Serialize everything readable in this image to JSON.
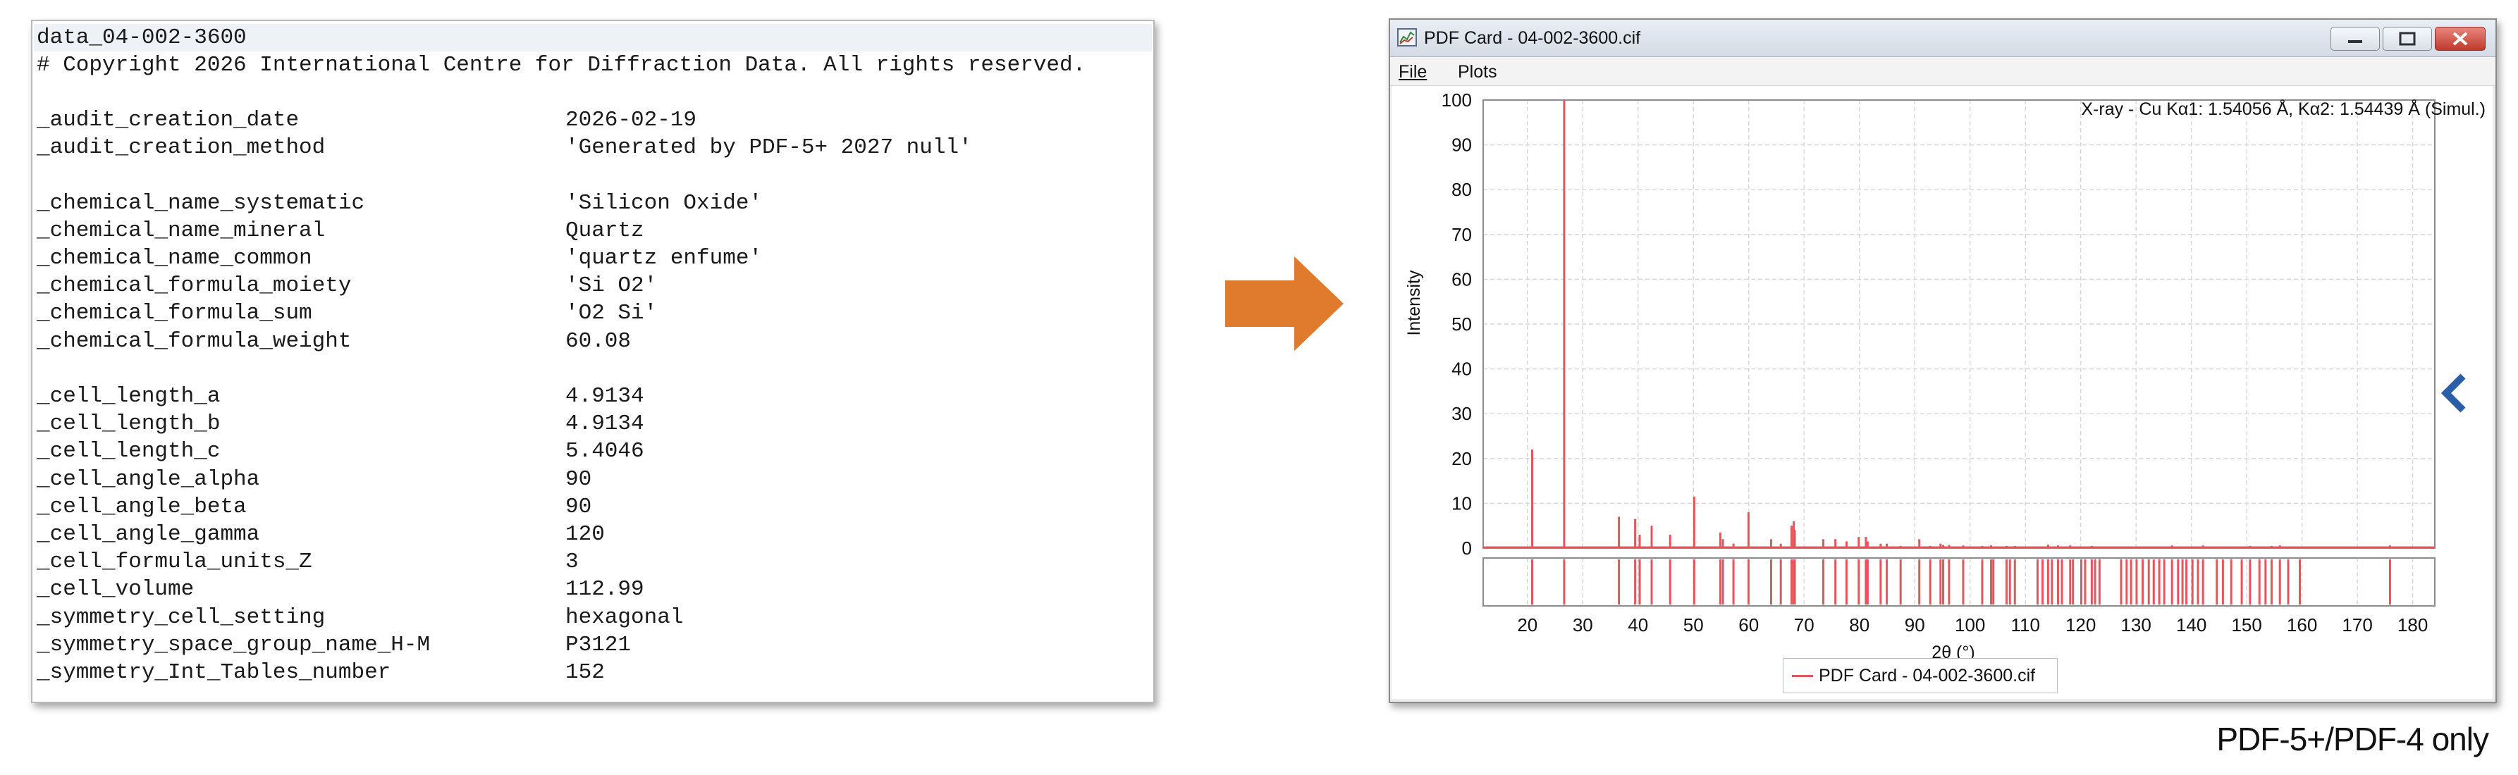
{
  "cif": {
    "header": "data_04-002-3600",
    "copyright": "# Copyright 2026 International Centre for Diffraction Data. All rights reserved.",
    "lines": [
      {
        "key": "_audit_creation_date",
        "value": "2026-02-19"
      },
      {
        "key": "_audit_creation_method",
        "value": "'Generated by PDF-5+ 2027 null'"
      },
      {
        "key": "",
        "value": ""
      },
      {
        "key": "_chemical_name_systematic",
        "value": "'Silicon Oxide'"
      },
      {
        "key": "_chemical_name_mineral",
        "value": "Quartz"
      },
      {
        "key": "_chemical_name_common",
        "value": "'quartz enfume'"
      },
      {
        "key": "_chemical_formula_moiety",
        "value": "'Si O2'"
      },
      {
        "key": "_chemical_formula_sum",
        "value": "'O2 Si'"
      },
      {
        "key": "_chemical_formula_weight",
        "value": "60.08"
      },
      {
        "key": "",
        "value": ""
      },
      {
        "key": "_cell_length_a",
        "value": "4.9134"
      },
      {
        "key": "_cell_length_b",
        "value": "4.9134"
      },
      {
        "key": "_cell_length_c",
        "value": "5.4046"
      },
      {
        "key": "_cell_angle_alpha",
        "value": "90"
      },
      {
        "key": "_cell_angle_beta",
        "value": "90"
      },
      {
        "key": "_cell_angle_gamma",
        "value": "120"
      },
      {
        "key": "_cell_formula_units_Z",
        "value": "3"
      },
      {
        "key": "_cell_volume",
        "value": "112.99"
      },
      {
        "key": "_symmetry_cell_setting",
        "value": "hexagonal"
      },
      {
        "key": "_symmetry_space_group_name_H-M",
        "value": "P3121"
      },
      {
        "key": "_symmetry_Int_Tables_number",
        "value": "152"
      }
    ]
  },
  "arrow": {
    "icon": "right-arrow-icon",
    "color": "#e07b2e"
  },
  "pdf_window": {
    "title": "PDF Card - 04-002-3600.cif",
    "menu": {
      "file": "File",
      "plots": "Plots"
    },
    "colors": {
      "peak": "#e8545c",
      "grid": "#d9d9d9",
      "chevron": "#2a5fa8"
    }
  },
  "chart_data": {
    "type": "line",
    "annotation": "X-ray - Cu Kα1: 1.54056 Å, Kα2: 1.54439 Å (Simul.)",
    "xlabel": "2θ (°)",
    "ylabel": "Intensity",
    "xlim": [
      12,
      184
    ],
    "ylim": [
      0,
      100
    ],
    "x_ticks": [
      20,
      30,
      40,
      50,
      60,
      70,
      80,
      90,
      100,
      110,
      120,
      130,
      140,
      150,
      160,
      170,
      180
    ],
    "y_ticks": [
      0,
      10,
      20,
      30,
      40,
      50,
      60,
      70,
      80,
      90,
      100
    ],
    "grid": true,
    "legend": "bottom-center",
    "series": [
      {
        "name": "PDF Card - 04-002-3600.cif"
      }
    ],
    "peaks": [
      {
        "x": 20.86,
        "y": 22
      },
      {
        "x": 26.64,
        "y": 100
      },
      {
        "x": 36.54,
        "y": 7
      },
      {
        "x": 39.47,
        "y": 6.5
      },
      {
        "x": 40.29,
        "y": 3
      },
      {
        "x": 42.45,
        "y": 5
      },
      {
        "x": 45.79,
        "y": 3
      },
      {
        "x": 50.14,
        "y": 11.5
      },
      {
        "x": 54.87,
        "y": 3.5
      },
      {
        "x": 55.33,
        "y": 2
      },
      {
        "x": 57.24,
        "y": 1
      },
      {
        "x": 59.96,
        "y": 8
      },
      {
        "x": 64.04,
        "y": 2
      },
      {
        "x": 65.79,
        "y": 1
      },
      {
        "x": 67.74,
        "y": 5
      },
      {
        "x": 68.14,
        "y": 6
      },
      {
        "x": 68.32,
        "y": 4
      },
      {
        "x": 73.47,
        "y": 2
      },
      {
        "x": 75.66,
        "y": 2
      },
      {
        "x": 77.67,
        "y": 1.5
      },
      {
        "x": 79.88,
        "y": 2.5
      },
      {
        "x": 81.17,
        "y": 2.5
      },
      {
        "x": 81.49,
        "y": 1.5
      },
      {
        "x": 83.84,
        "y": 1
      },
      {
        "x": 84.95,
        "y": 1
      },
      {
        "x": 87.45,
        "y": 0.5
      },
      {
        "x": 90.83,
        "y": 2
      },
      {
        "x": 92.8,
        "y": 0.5
      },
      {
        "x": 94.66,
        "y": 1
      },
      {
        "x": 95.14,
        "y": 0.7
      },
      {
        "x": 96.2,
        "y": 0.7
      },
      {
        "x": 98.76,
        "y": 0.6
      },
      {
        "x": 102.2,
        "y": 0.5
      },
      {
        "x": 103.8,
        "y": 0.6
      },
      {
        "x": 106.6,
        "y": 0.5
      },
      {
        "x": 108.1,
        "y": 0.5
      },
      {
        "x": 114.1,
        "y": 0.8
      },
      {
        "x": 115.9,
        "y": 0.6
      },
      {
        "x": 118.1,
        "y": 0.6
      },
      {
        "x": 122.0,
        "y": 0.5
      },
      {
        "x": 123.4,
        "y": 0.4
      },
      {
        "x": 127.3,
        "y": 0.4
      },
      {
        "x": 136.5,
        "y": 0.6
      },
      {
        "x": 139.1,
        "y": 0.4
      },
      {
        "x": 142.1,
        "y": 0.6
      },
      {
        "x": 144.6,
        "y": 0.4
      },
      {
        "x": 147.2,
        "y": 0.4
      },
      {
        "x": 150.6,
        "y": 0.5
      },
      {
        "x": 154.5,
        "y": 0.5
      },
      {
        "x": 156.0,
        "y": 0.6
      },
      {
        "x": 159.6,
        "y": 0.4
      },
      {
        "x": 175.9,
        "y": 0.6
      }
    ],
    "reflections": [
      20.86,
      26.64,
      36.54,
      39.47,
      40.29,
      42.45,
      45.79,
      50.14,
      54.87,
      55.33,
      57.24,
      59.96,
      64.04,
      65.79,
      67.74,
      68.14,
      68.32,
      73.47,
      75.66,
      77.67,
      79.88,
      81.17,
      81.49,
      83.84,
      84.95,
      87.45,
      90.83,
      92.8,
      94.66,
      95.14,
      96.2,
      98.76,
      102.2,
      103.8,
      104.2,
      106.6,
      107.2,
      108.1,
      112.2,
      113.1,
      114.1,
      114.8,
      115.9,
      116.6,
      118.1,
      118.6,
      120.1,
      120.8,
      122.0,
      122.6,
      123.4,
      127.3,
      128.3,
      129.1,
      130.1,
      131.2,
      132.3,
      133.2,
      134.2,
      135.1,
      136.5,
      137.6,
      138.4,
      139.1,
      140.2,
      141.2,
      142.1,
      144.6,
      145.7,
      147.2,
      149.1,
      150.6,
      152.3,
      153.4,
      154.5,
      156.0,
      157.5,
      159.6,
      175.9
    ]
  },
  "footer": {
    "note": "PDF-5+/PDF-4 only"
  }
}
